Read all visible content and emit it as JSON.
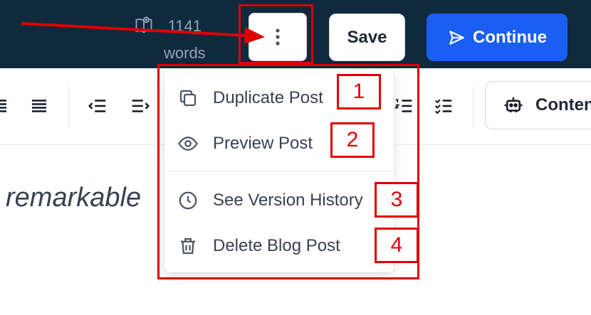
{
  "header": {
    "word_count": "1141",
    "word_unit": "words",
    "save_label": "Save",
    "continue_label": "Continue"
  },
  "toolbar": {
    "content_button_label": "Content"
  },
  "editor": {
    "visible_text": "remarkable"
  },
  "menu": {
    "items": [
      {
        "label": "Duplicate Post",
        "icon": "copy-icon"
      },
      {
        "label": "Preview Post",
        "icon": "eye-icon"
      },
      {
        "label": "See Version History",
        "icon": "clock-icon"
      },
      {
        "label": "Delete Blog Post",
        "icon": "trash-icon"
      }
    ]
  },
  "annotations": {
    "numbers": [
      "1",
      "2",
      "3",
      "4"
    ],
    "color": "#e00000"
  },
  "colors": {
    "header_bg": "#0f2a3d",
    "primary": "#1a5ff2"
  }
}
